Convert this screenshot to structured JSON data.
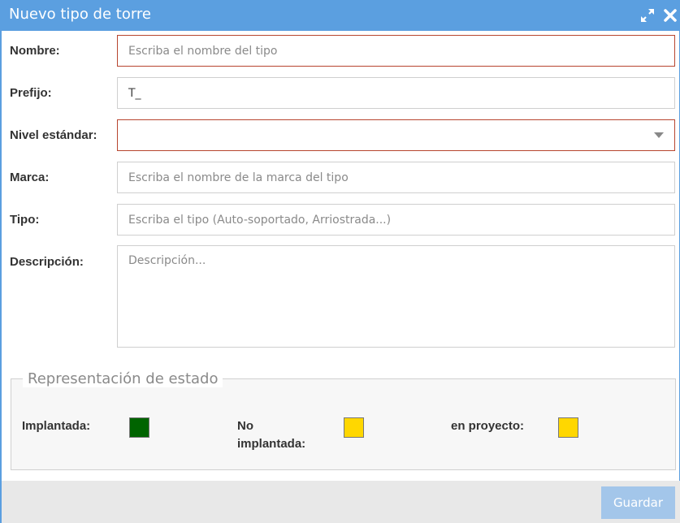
{
  "dialog": {
    "title": "Nuevo tipo de torre",
    "icons": {
      "expand": "expand-icon",
      "close": "close-icon"
    }
  },
  "form": {
    "nombre": {
      "label": "Nombre:",
      "value": "",
      "placeholder": "Escriba el nombre del tipo"
    },
    "prefijo": {
      "label": "Prefijo:",
      "value": "T_",
      "placeholder": ""
    },
    "nivel": {
      "label": "Nivel estándar:",
      "selected": ""
    },
    "marca": {
      "label": "Marca:",
      "value": "",
      "placeholder": "Escriba el nombre de la marca del tipo"
    },
    "tipo": {
      "label": "Tipo:",
      "value": "",
      "placeholder": "Escriba el tipo (Auto-soportado, Arriostrada...)"
    },
    "descripcion": {
      "label": "Descripción:",
      "value": "",
      "placeholder": "Descripción..."
    }
  },
  "estado": {
    "legend": "Representación de estado",
    "implantada": {
      "label": "Implantada:",
      "color": "#006400"
    },
    "no_implantada": {
      "label_line1": "No",
      "label_line2": "implantada:",
      "color": "#ffd700"
    },
    "en_proyecto": {
      "label": "en proyecto:",
      "color": "#ffd700"
    }
  },
  "footer": {
    "save_label": "Guardar"
  },
  "colors": {
    "titlebar": "#5b9fe0",
    "error_border": "#b7452f",
    "save_button": "#a3c6ea"
  }
}
